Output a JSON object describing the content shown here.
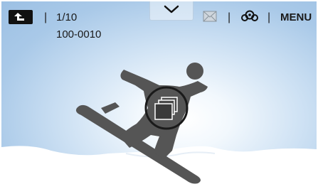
{
  "statusbar": {
    "counter": "1/10",
    "file_number": "100-0010",
    "separator": "|",
    "menu_label": "MENU",
    "icons": {
      "back": "back-arrow-icon",
      "dropdown": "chevron-down-icon",
      "mail": "envelope-icon",
      "share": "share-icon"
    }
  },
  "preview": {
    "center_icon": "gallery-folders-icon"
  },
  "colors": {
    "sky_light": "#ffffff",
    "sky_dark": "#9cc0e4",
    "silhouette": "#555555",
    "snow": "#ffffff"
  }
}
